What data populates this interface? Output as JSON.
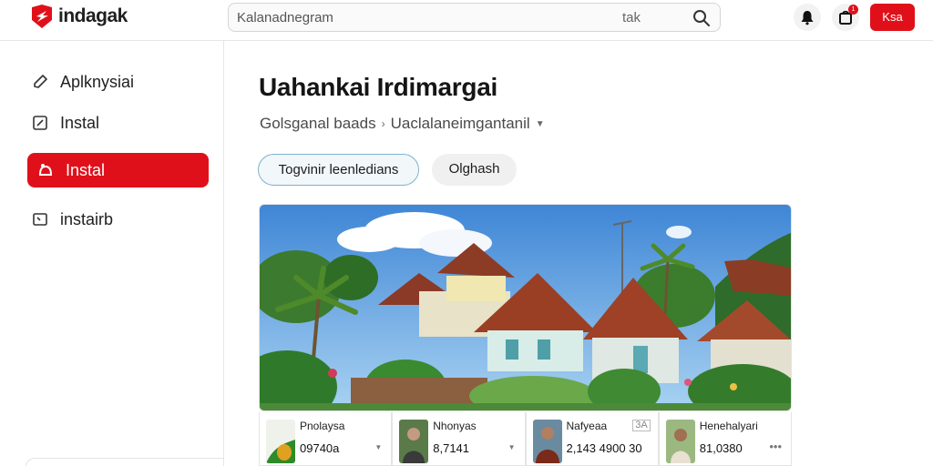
{
  "app": {
    "name": "indagak"
  },
  "search": {
    "value": "Kalanadnegram",
    "hint": "tak"
  },
  "header": {
    "cart_count": "1",
    "account_label": "Ksa"
  },
  "sidebar": {
    "items": [
      {
        "label": "Aplknysiai",
        "icon": "pencil-icon"
      },
      {
        "label": "Instal",
        "icon": "edit-box-icon"
      },
      {
        "label": "Instal",
        "icon": "home-icon",
        "active": true
      },
      {
        "label": "instairb",
        "icon": "tray-icon"
      }
    ]
  },
  "main": {
    "title": "Uahankai Irdimargai",
    "breadcrumb": [
      "Golsganal baads",
      "Uaclalaneimgantanil"
    ],
    "pills": {
      "primary": "Togvinir leenledians",
      "secondary": "Olghash"
    }
  },
  "cards": [
    {
      "name": "Pnolaysa",
      "price": "09740a"
    },
    {
      "name": "Nhonyas",
      "price": "8,7141"
    },
    {
      "name": "Nafyeaa",
      "price": "2,143 4900 30",
      "tag": "3A"
    },
    {
      "name": "Henehalyari",
      "price": "81,0380"
    }
  ],
  "colors": {
    "accent": "#e0101a",
    "pill_border": "#7fb2cc"
  }
}
